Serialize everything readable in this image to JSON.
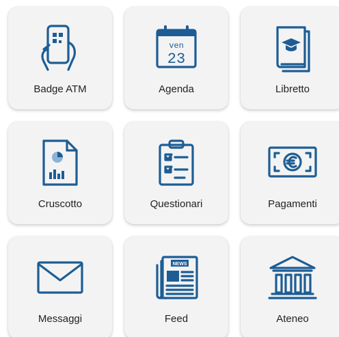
{
  "tiles": [
    {
      "label": "Badge ATM",
      "icon": "phone-hand-icon"
    },
    {
      "label": "Agenda",
      "icon": "calendar-icon",
      "day": "ven",
      "date": "23"
    },
    {
      "label": "Libretto",
      "icon": "book-graduation-icon"
    },
    {
      "label": "Cruscotto",
      "icon": "report-chart-icon"
    },
    {
      "label": "Questionari",
      "icon": "clipboard-checklist-icon"
    },
    {
      "label": "Pagamenti",
      "icon": "euro-banknote-icon"
    },
    {
      "label": "Messaggi",
      "icon": "envelope-icon"
    },
    {
      "label": "Feed",
      "icon": "newspaper-icon",
      "badge": "NEWS"
    },
    {
      "label": "Ateneo",
      "icon": "university-building-icon"
    }
  ],
  "colors": {
    "accent": "#1d5d94",
    "tile_bg": "#f3f3f4",
    "text": "#222222"
  }
}
